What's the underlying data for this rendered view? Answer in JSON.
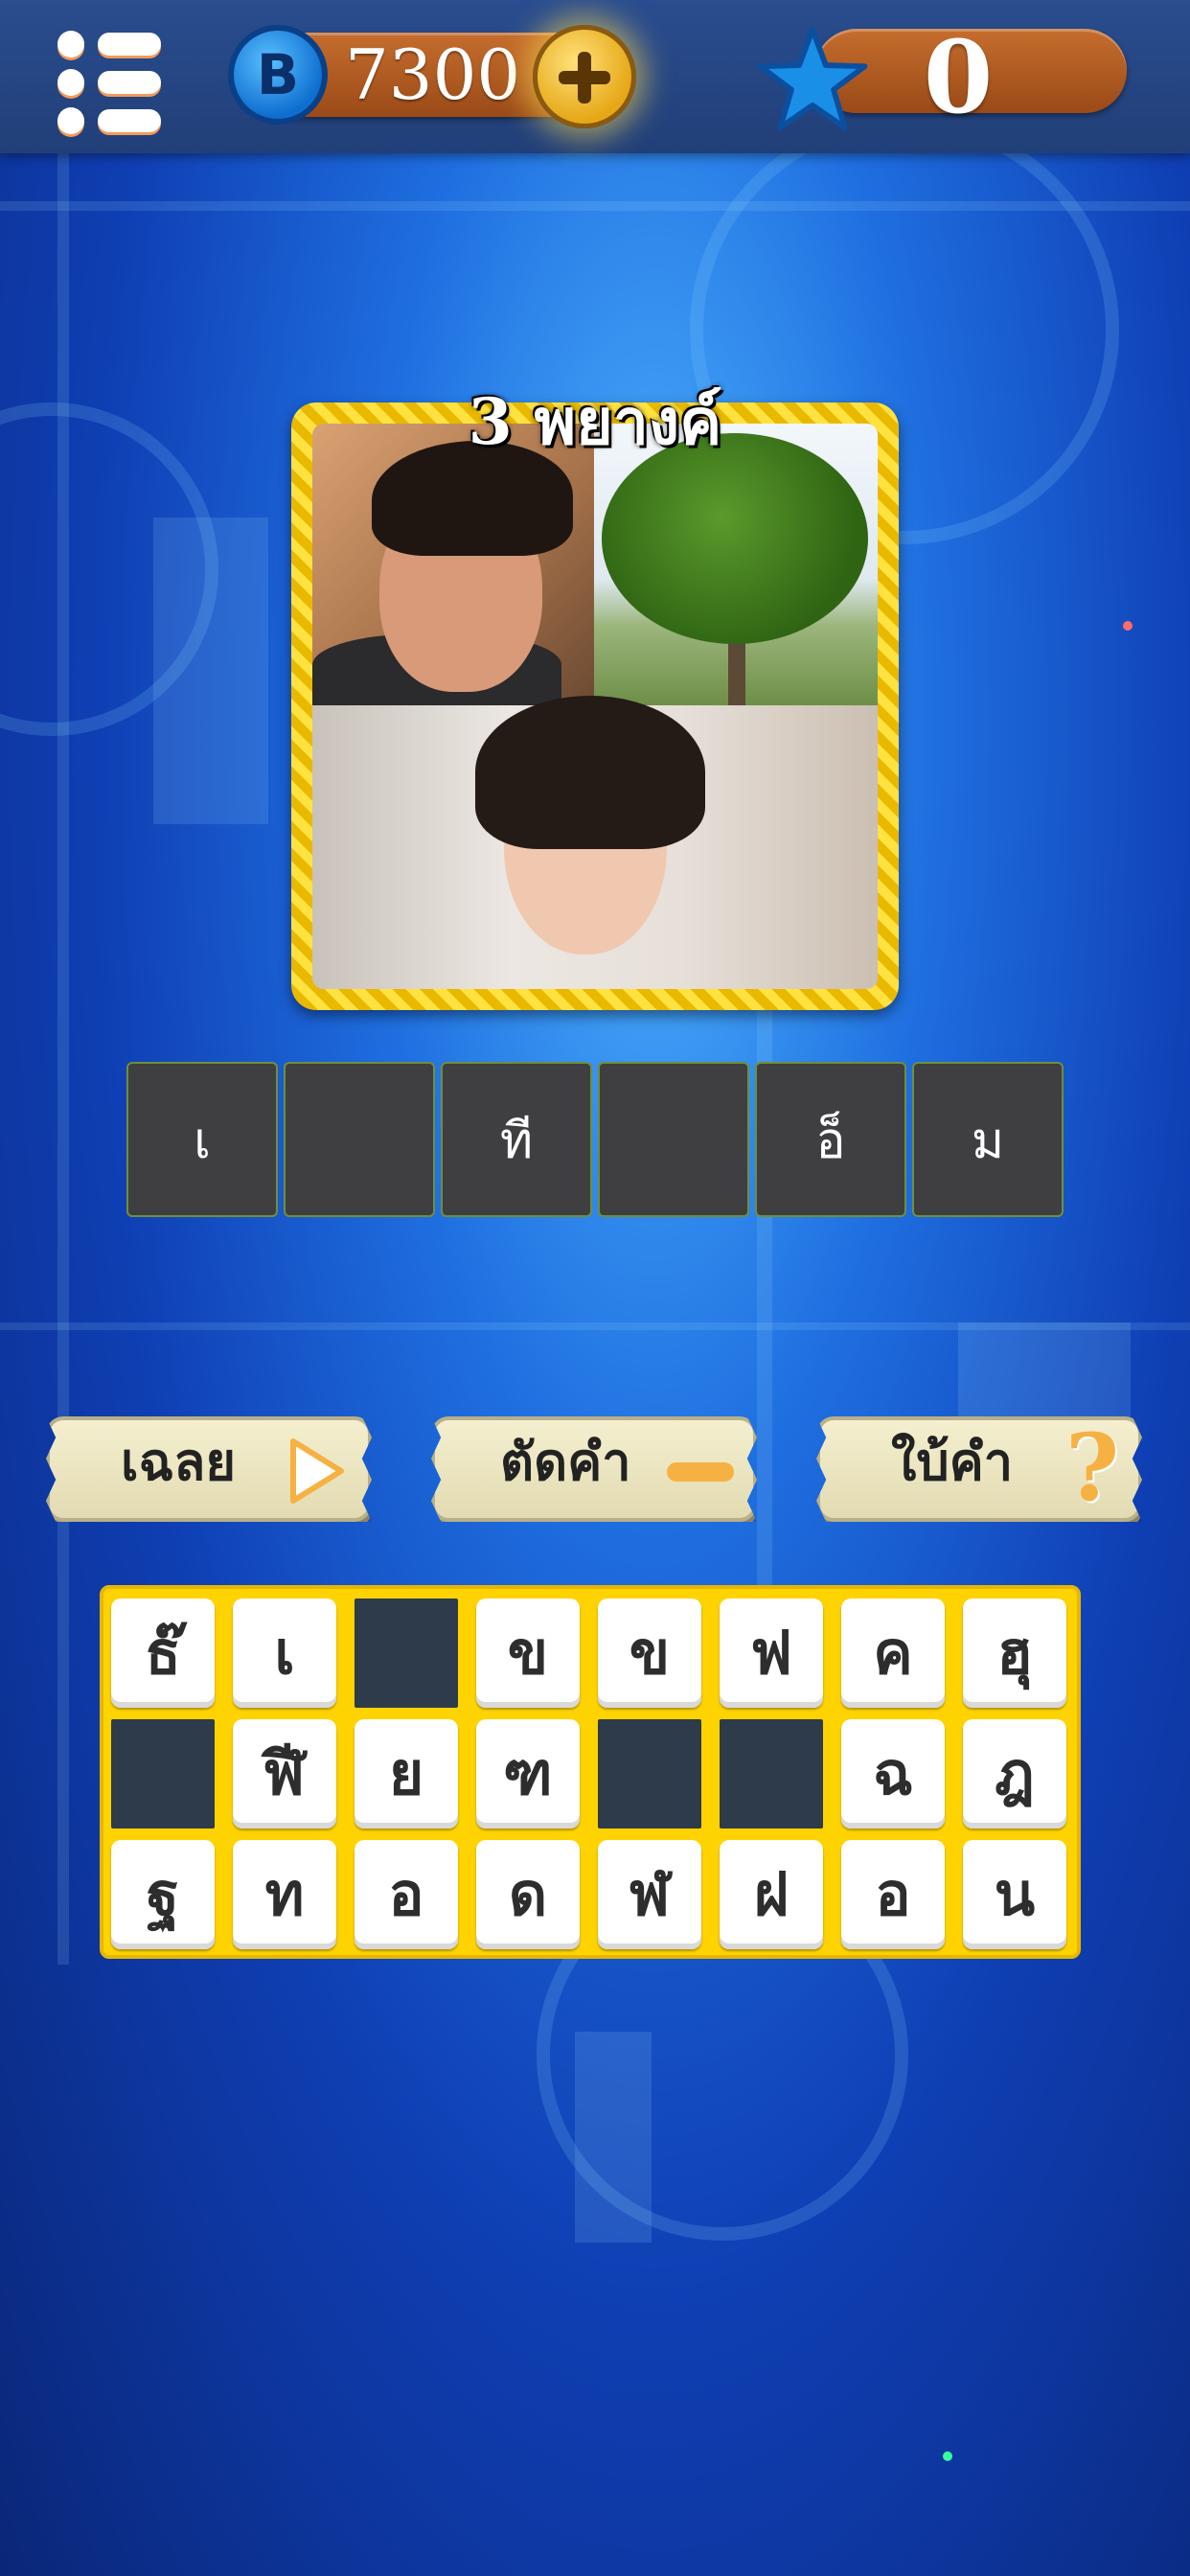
{
  "header": {
    "coin_symbol": "B",
    "coins": "7300",
    "stars": "0",
    "icons": [
      "menu-icon",
      "coin-icon",
      "plus-icon",
      "star-icon"
    ]
  },
  "puzzle": {
    "title": "3 พยางค์",
    "answer_slots": [
      "เ",
      "",
      "ที",
      "",
      "อ็",
      "ม"
    ]
  },
  "actions": [
    {
      "label": "เฉลย",
      "icon": "play-icon"
    },
    {
      "label": "ตัดคำ",
      "icon": "minus-icon"
    },
    {
      "label": "ใบ้คำ",
      "icon": "question-icon"
    }
  ],
  "letters": [
    [
      "ธ๊",
      "เ",
      "",
      "ข",
      "ข",
      "ฟ",
      "ค",
      "ฮุ"
    ],
    [
      "",
      "ฬี",
      "ย",
      "ฑ",
      "",
      "",
      "ฉ",
      "ฎ"
    ],
    [
      "ฐ",
      "ท",
      "อ",
      "ด",
      "ฬ",
      "ฝ",
      "อ",
      "น"
    ]
  ],
  "colors": {
    "board": "#ffd300",
    "slot": "#3f3f41",
    "coin_pill": "#b15c22",
    "accent": "#f6b143"
  }
}
